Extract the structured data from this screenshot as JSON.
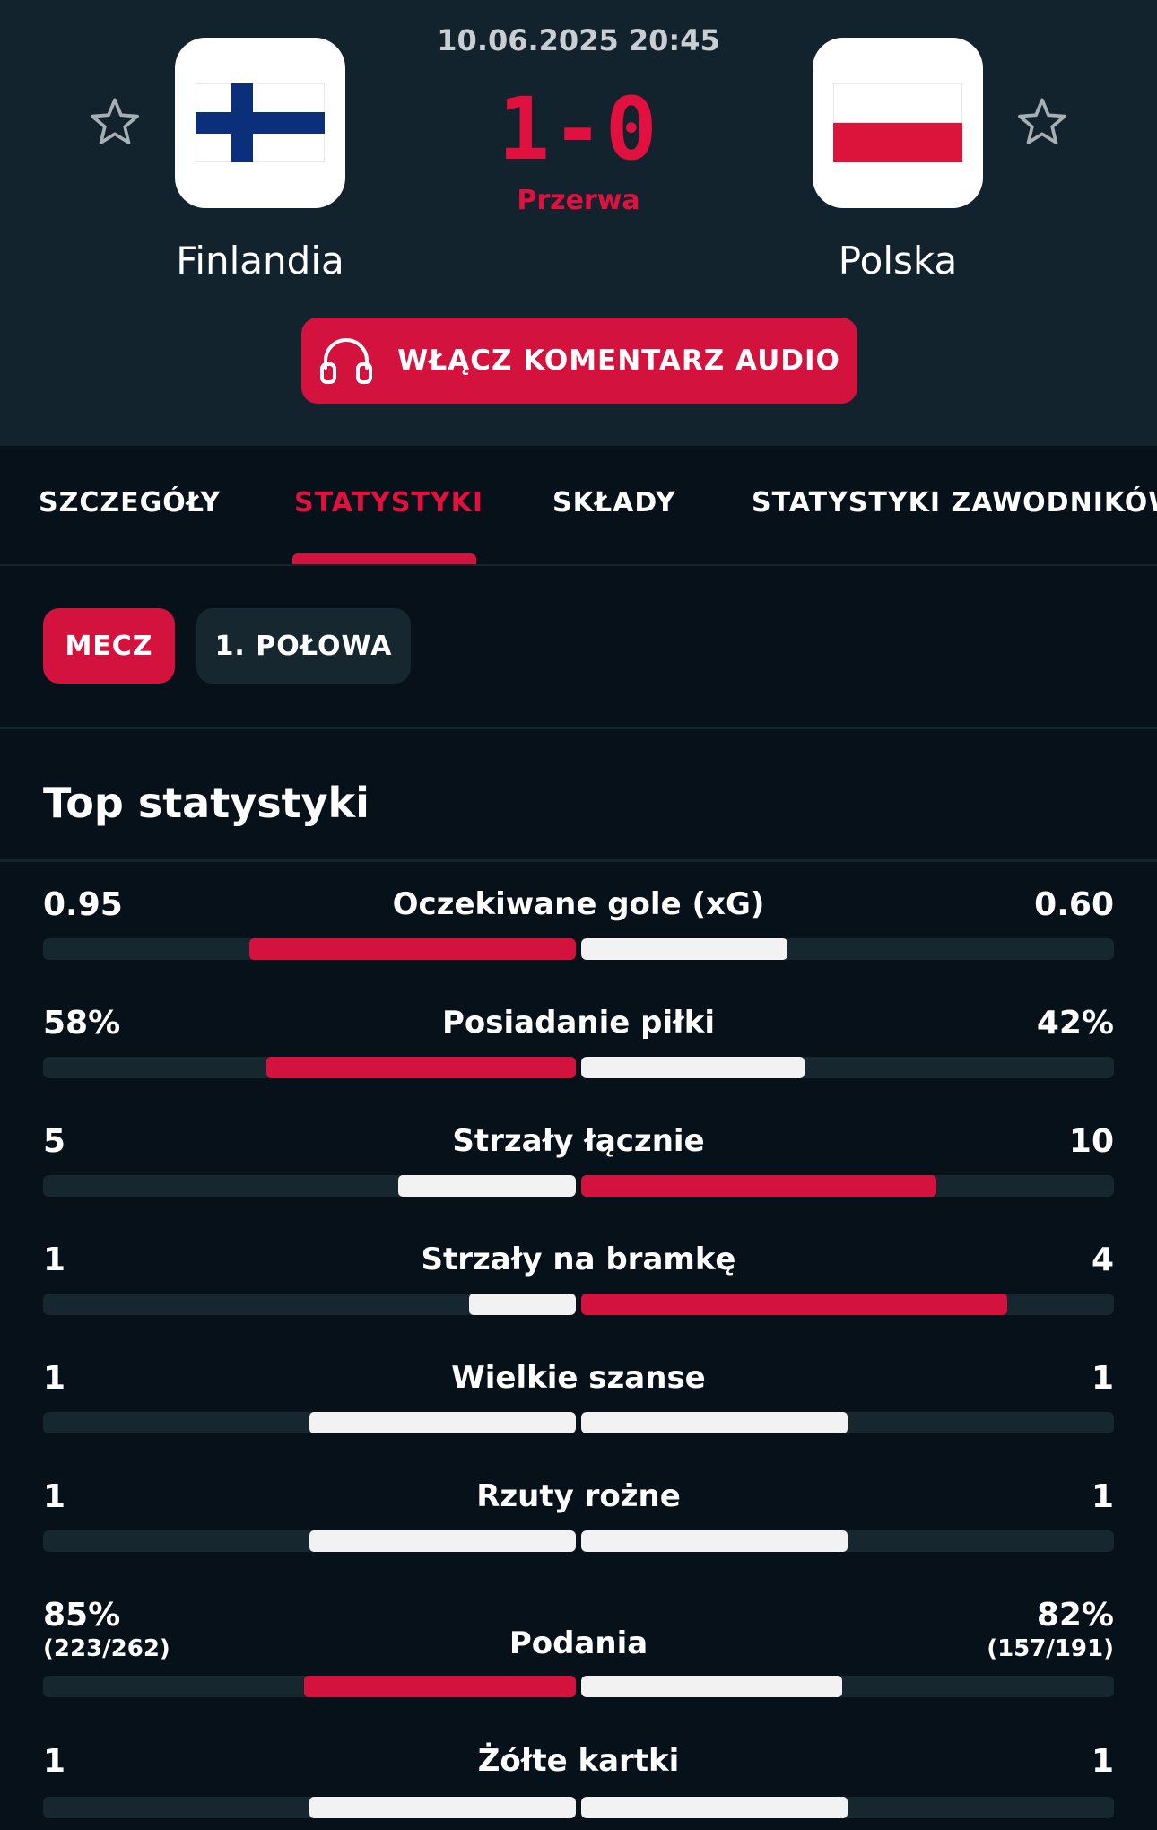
{
  "match": {
    "datetime": "10.06.2025 20:45",
    "score": "1-0",
    "status": "Przerwa",
    "home": {
      "name": "Finlandia",
      "flag": "finland-flag-icon"
    },
    "away": {
      "name": "Polska",
      "flag": "poland-flag-icon"
    },
    "audio_button": "WŁĄCZ KOMENTARZ AUDIO"
  },
  "tabs": [
    "SZCZEGÓŁY",
    "STATYSTYKI",
    "SKŁADY",
    "STATYSTYKI ZAWODNIKÓW"
  ],
  "active_tab": "STATYSTYKI",
  "period_filters": [
    "MECZ",
    "1. POŁOWA"
  ],
  "active_period": "MECZ",
  "section_title": "Top statystyki",
  "colors": {
    "accent": "#d3133e",
    "bar_white": "#f2f2f2",
    "track": "#16272f",
    "header_bg": "#13232e",
    "page_bg": "#07111a"
  },
  "stats": [
    {
      "name": "Oczekiwane gole (xG)",
      "home": "0.95",
      "away": "0.60",
      "home_sub": "",
      "away_sub": "",
      "home_frac": 0.613,
      "away_frac": 0.387,
      "leader": "home"
    },
    {
      "name": "Posiadanie piłki",
      "home": "58%",
      "away": "42%",
      "home_sub": "",
      "away_sub": "",
      "home_frac": 0.58,
      "away_frac": 0.42,
      "leader": "home"
    },
    {
      "name": "Strzały łącznie",
      "home": "5",
      "away": "10",
      "home_sub": "",
      "away_sub": "",
      "home_frac": 0.333,
      "away_frac": 0.667,
      "leader": "away"
    },
    {
      "name": "Strzały na bramkę",
      "home": "1",
      "away": "4",
      "home_sub": "",
      "away_sub": "",
      "home_frac": 0.2,
      "away_frac": 0.8,
      "leader": "away"
    },
    {
      "name": "Wielkie szanse",
      "home": "1",
      "away": "1",
      "home_sub": "",
      "away_sub": "",
      "home_frac": 0.5,
      "away_frac": 0.5,
      "leader": "none"
    },
    {
      "name": "Rzuty rożne",
      "home": "1",
      "away": "1",
      "home_sub": "",
      "away_sub": "",
      "home_frac": 0.5,
      "away_frac": 0.5,
      "leader": "none"
    },
    {
      "name": "Podania",
      "home": "85%",
      "away": "82%",
      "home_sub": "(223/262)",
      "away_sub": "(157/191)",
      "home_frac": 0.51,
      "away_frac": 0.49,
      "leader": "home"
    },
    {
      "name": "Żółte kartki",
      "home": "1",
      "away": "1",
      "home_sub": "",
      "away_sub": "",
      "home_frac": 0.5,
      "away_frac": 0.5,
      "leader": "none"
    }
  ]
}
